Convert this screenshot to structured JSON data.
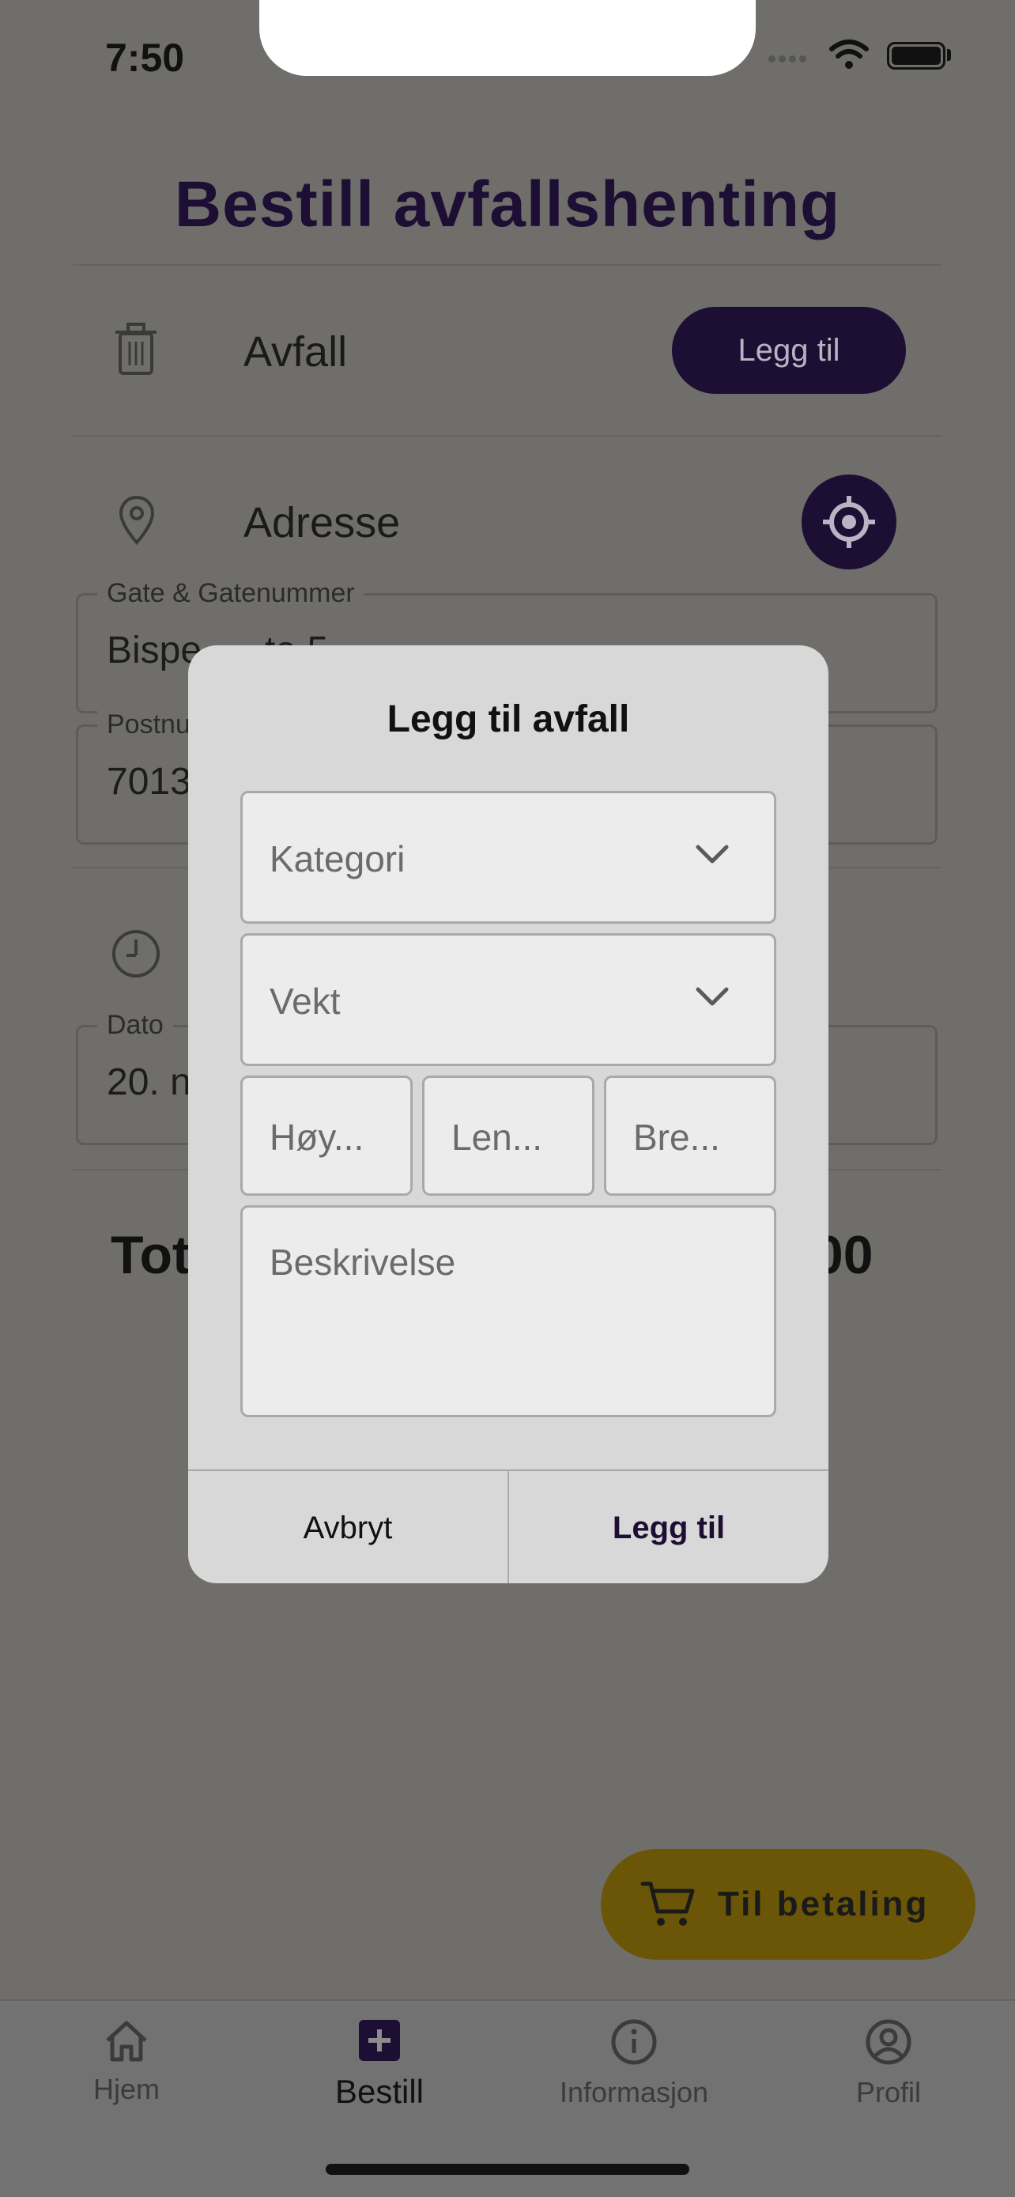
{
  "status": {
    "time": "7:50"
  },
  "page": {
    "title": "Bestill avfallshenting"
  },
  "waste_row": {
    "label": "Avfall",
    "button": "Legg til"
  },
  "address_row": {
    "label": "Adresse"
  },
  "street_field": {
    "label": "Gate & Gatenummer",
    "value": "Bispe      ta 5"
  },
  "postal_field": {
    "label": "Postnu",
    "value": "7013"
  },
  "date_field": {
    "label": "Dato",
    "value": "20. n"
  },
  "total": {
    "label": "Tot",
    "amount": ".00"
  },
  "checkout": {
    "label": "Til betaling"
  },
  "tabs": [
    {
      "label": "Hjem",
      "icon": "home-icon"
    },
    {
      "label": "Bestill",
      "icon": "plus-square-icon"
    },
    {
      "label": "Informasjon",
      "icon": "info-icon"
    },
    {
      "label": "Profil",
      "icon": "profile-icon"
    }
  ],
  "dialog": {
    "title": "Legg til avfall",
    "category_placeholder": "Kategori",
    "weight_placeholder": "Vekt",
    "height_placeholder": "Høy...",
    "length_placeholder": "Len...",
    "width_placeholder": "Bre...",
    "description_placeholder": "Beskrivelse",
    "cancel": "Avbryt",
    "confirm": "Legg til"
  },
  "colors": {
    "primary": "#1d0f33",
    "accent": "#e5b90f",
    "overlay": "#6f6e6b"
  }
}
